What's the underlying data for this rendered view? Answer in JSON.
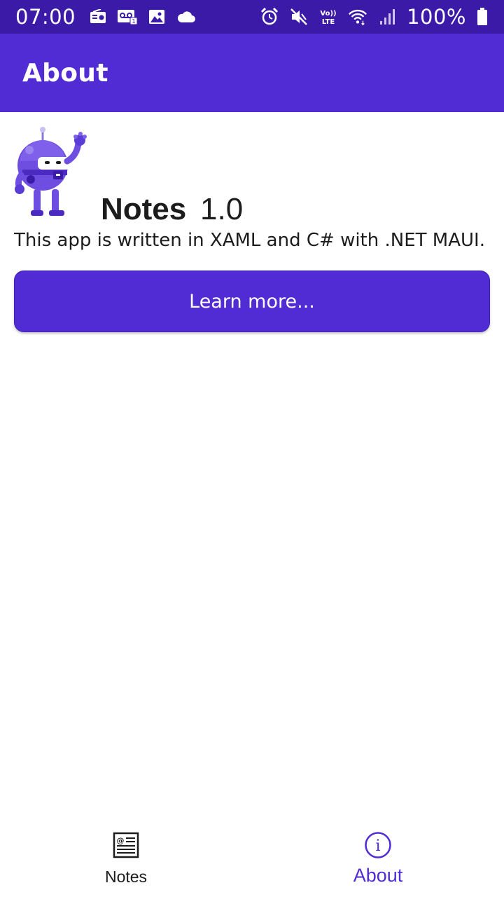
{
  "status_bar": {
    "time": "07:00",
    "battery_percent": "100%",
    "left_icons": [
      "radio-icon",
      "voicemail-icon",
      "image-icon",
      "cloud-icon"
    ],
    "right_icons": [
      "alarm-icon",
      "mute-icon",
      "volte-icon",
      "wifi-icon",
      "signal-icon",
      "battery-icon"
    ],
    "volte_label": "Vo))\nLTE"
  },
  "app_bar": {
    "title": "About",
    "background": "#512bd4"
  },
  "about": {
    "app_name": "Notes",
    "version": "1.0",
    "description": "This app is written in XAML and C# with .NET MAUI.",
    "learn_more_label": "Learn more..."
  },
  "tabs": [
    {
      "label": "Notes",
      "icon": "notes-icon",
      "selected": false
    },
    {
      "label": "About",
      "icon": "info-icon",
      "selected": true
    }
  ],
  "colors": {
    "primary": "#512bd4",
    "status_bar": "#3b1aa8",
    "text": "#1c1c1c"
  }
}
